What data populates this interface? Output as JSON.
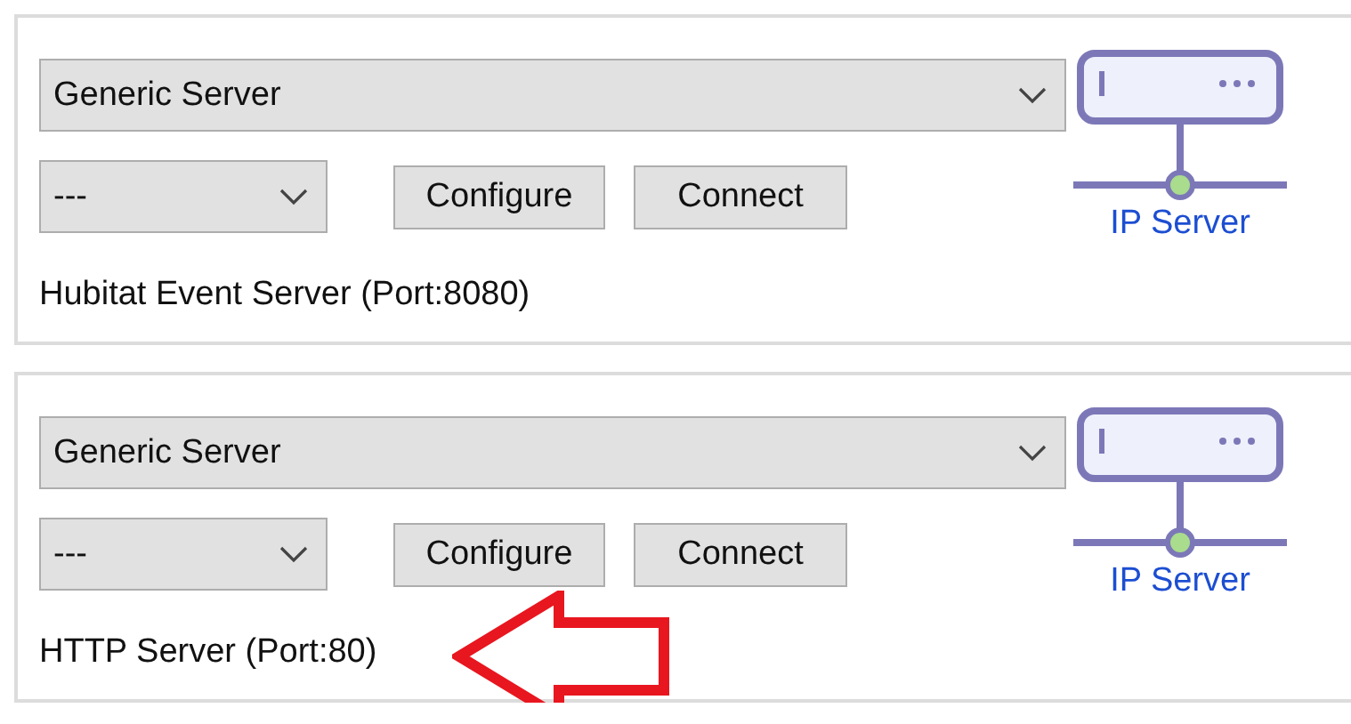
{
  "panels": [
    {
      "server_type": "Generic Server",
      "device": "---",
      "buttons": [
        "Configure",
        "Connect"
      ],
      "icon_label": "IP Server",
      "description": "Hubitat Event Server (Port:8080)",
      "highlighted": false
    },
    {
      "server_type": "Generic Server",
      "device": "---",
      "buttons": [
        "Configure",
        "Connect"
      ],
      "icon_label": "IP Server",
      "description": "HTTP Server (Port:80)",
      "highlighted": true
    }
  ]
}
